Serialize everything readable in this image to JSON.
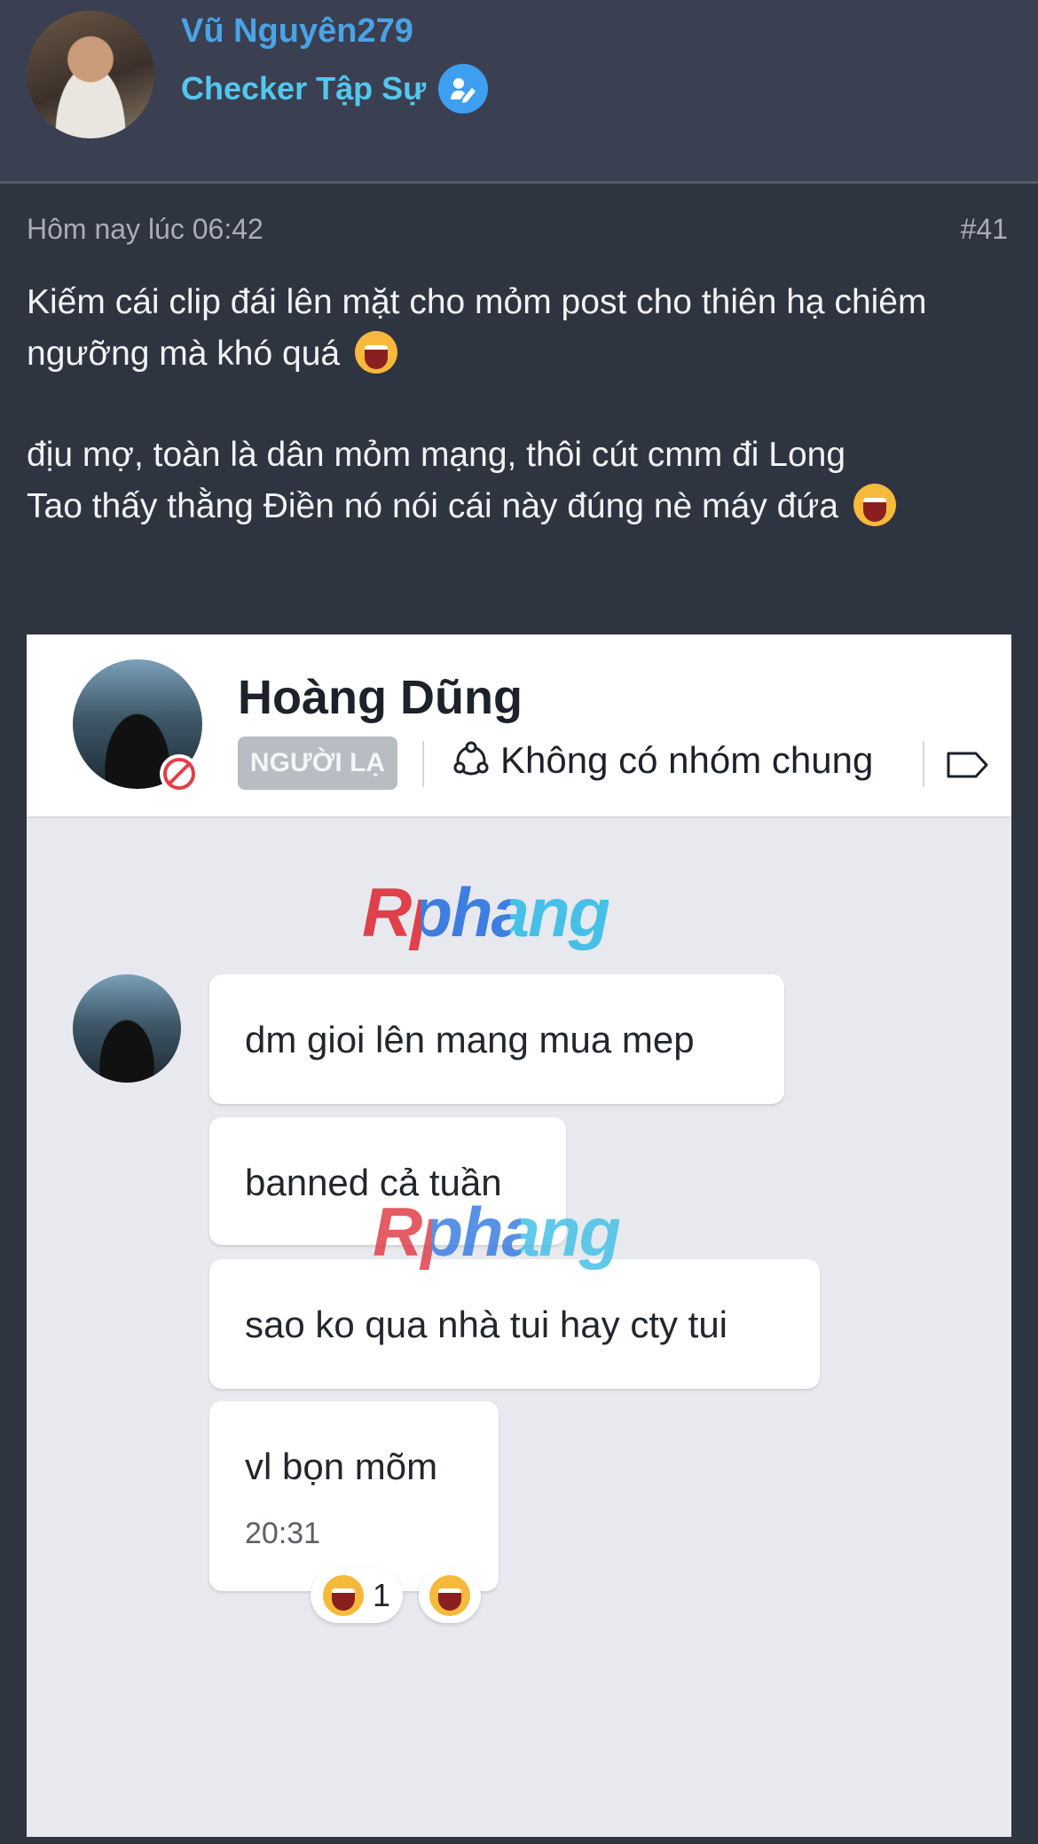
{
  "user": {
    "name": "Vũ Nguyên279",
    "title": "Checker Tập Sự",
    "badge_icon": "pen-badge-icon"
  },
  "post": {
    "time": "Hôm nay lúc 06:42",
    "number": "#41",
    "lines": [
      "Kiếm cái clip đái lên mặt cho mỏm post cho thiên hạ chiêm ngưỡng mà khó quá",
      "địu mợ, toàn là dân mỏm mạng, thôi cút cmm đi Long",
      "Tao thấy thằng Điền nó nói cái này đúng nè máy đứa"
    ],
    "emoji": "laughing-crying-emoji"
  },
  "screenshot": {
    "contact_name": "Hoàng Dũng",
    "stranger_tag": "NGƯỜI LẠ",
    "common_group": "Không có nhóm chung",
    "watermark": "Rphang",
    "messages": [
      "dm gioi lên mang mua mep",
      "banned cả tuần",
      "sao ko qua nhà tui hay cty tui",
      "vl bọn mõm"
    ],
    "message_time": "20:31",
    "reaction_count": "1"
  },
  "colors": {
    "page_bg": "#2f3441",
    "header_bg": "#3a4051",
    "username": "#4aa3e6",
    "usertitle": "#53c7ee",
    "meta": "#a8adb8"
  }
}
